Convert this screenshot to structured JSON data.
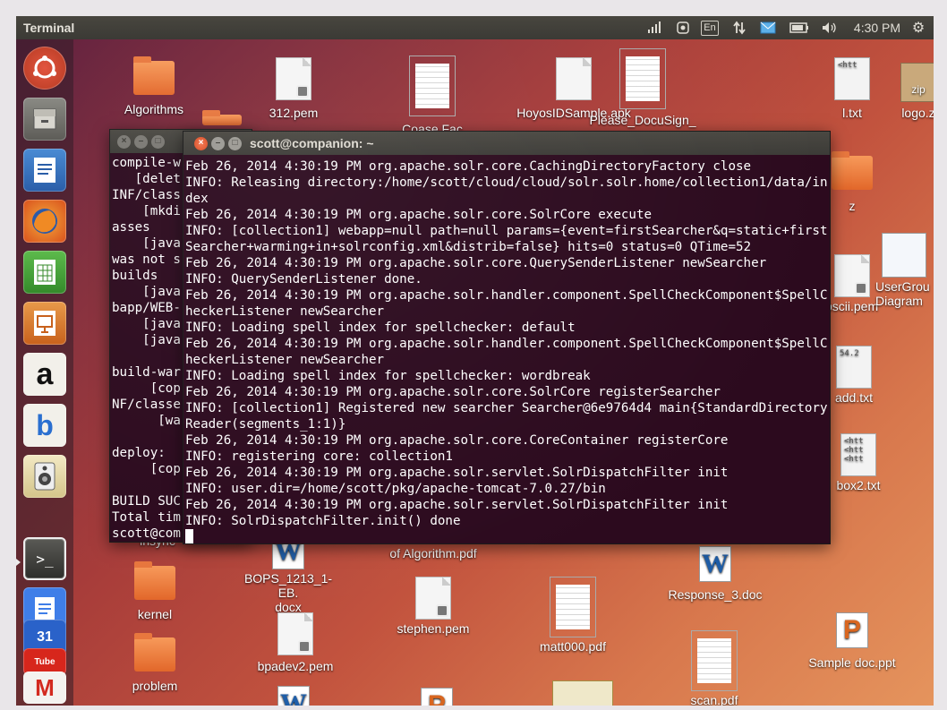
{
  "top_panel": {
    "app_title": "Terminal",
    "keyboard_layout": "En",
    "clock": "4:30 PM",
    "icons": [
      "network-signal-icon",
      "accessibility-icon",
      "keyboard-layout-indicator",
      "network-transfer-icon",
      "mail-icon",
      "battery-icon",
      "volume-icon",
      "gear-icon"
    ]
  },
  "launcher": {
    "items": [
      {
        "name": "dash-home-icon",
        "glyph": "◉"
      },
      {
        "name": "files-icon",
        "glyph": "▤"
      },
      {
        "name": "writer-icon",
        "glyph": "▦"
      },
      {
        "name": "firefox-icon",
        "glyph": "●"
      },
      {
        "name": "calc-icon",
        "glyph": "▥"
      },
      {
        "name": "impress-icon",
        "glyph": "▧"
      },
      {
        "name": "amazon-icon",
        "glyph": "a"
      },
      {
        "name": "bluetooth-icon",
        "glyph": "b"
      },
      {
        "name": "speaker-icon",
        "glyph": "◎"
      },
      {
        "name": "terminal-icon",
        "glyph": ">_"
      },
      {
        "name": "docs-icon",
        "glyph": "≡"
      },
      {
        "name": "calendar-icon",
        "glyph": "31"
      },
      {
        "name": "youtube-icon",
        "glyph": "Tube"
      },
      {
        "name": "gmail-icon",
        "glyph": "M"
      }
    ]
  },
  "desktop": {
    "icons": [
      {
        "label": "Algorithms"
      },
      {
        "label": "312.pem"
      },
      {
        "label": "Coase Fac"
      },
      {
        "label": "HoyosIDSample.apk"
      },
      {
        "label": "Please_DocuSign_"
      },
      {
        "label": "l.txt"
      },
      {
        "label": "logo.z"
      },
      {
        "label": "z"
      },
      {
        "label": "pscii.pem"
      },
      {
        "label": "UserGrou"
      },
      {
        "label": "Diagram"
      },
      {
        "label": "add.txt"
      },
      {
        "label": "box2.txt"
      },
      {
        "label": "insync"
      },
      {
        "label": "BOPS_1213_1-EB."
      },
      {
        "label": "docx"
      },
      {
        "label": "of Algorithm.pdf"
      },
      {
        "label": "Response_3.doc"
      },
      {
        "label": "kernel"
      },
      {
        "label": "stephen.pem"
      },
      {
        "label": "matt000.pdf"
      },
      {
        "label": "bpadev2.pem"
      },
      {
        "label": "Sample doc.ppt"
      },
      {
        "label": "problem"
      },
      {
        "label": "scan.pdf"
      }
    ]
  },
  "back_terminal": {
    "lines": [
      "compile-w",
      "   [delet",
      "INF/class",
      "    [mkdi",
      "asses",
      "    [java",
      "was not s",
      "builds",
      "    [java",
      "bapp/WEB-",
      "    [java",
      "    [java",
      "",
      "build-war",
      "     [cop",
      "NF/classe",
      "      [wa",
      "",
      "deploy:",
      "     [cop",
      "",
      "BUILD SUC",
      "Total tim",
      "scott@com"
    ]
  },
  "front_terminal": {
    "title": "scott@companion: ~",
    "lines": [
      "Feb 26, 2014 4:30:19 PM org.apache.solr.core.CachingDirectoryFactory close",
      "INFO: Releasing directory:/home/scott/cloud/cloud/solr.solr.home/collection1/data/index",
      "Feb 26, 2014 4:30:19 PM org.apache.solr.core.SolrCore execute",
      "INFO: [collection1] webapp=null path=null params={event=firstSearcher&q=static+firstSearcher+warming+in+solrconfig.xml&distrib=false} hits=0 status=0 QTime=52",
      "Feb 26, 2014 4:30:19 PM org.apache.solr.core.QuerySenderListener newSearcher",
      "INFO: QuerySenderListener done.",
      "Feb 26, 2014 4:30:19 PM org.apache.solr.handler.component.SpellCheckComponent$SpellCheckerListener newSearcher",
      "INFO: Loading spell index for spellchecker: default",
      "Feb 26, 2014 4:30:19 PM org.apache.solr.handler.component.SpellCheckComponent$SpellCheckerListener newSearcher",
      "INFO: Loading spell index for spellchecker: wordbreak",
      "Feb 26, 2014 4:30:19 PM org.apache.solr.core.SolrCore registerSearcher",
      "INFO: [collection1] Registered new searcher Searcher@6e9764d4 main{StandardDirectoryReader(segments_1:1)}",
      "Feb 26, 2014 4:30:19 PM org.apache.solr.core.CoreContainer registerCore",
      "INFO: registering core: collection1",
      "Feb 26, 2014 4:30:19 PM org.apache.solr.servlet.SolrDispatchFilter init",
      "INFO: user.dir=/home/scott/pkg/apache-tomcat-7.0.27/bin",
      "Feb 26, 2014 4:30:19 PM org.apache.solr.servlet.SolrDispatchFilter init",
      "INFO: SolrDispatchFilter.init() done"
    ]
  }
}
